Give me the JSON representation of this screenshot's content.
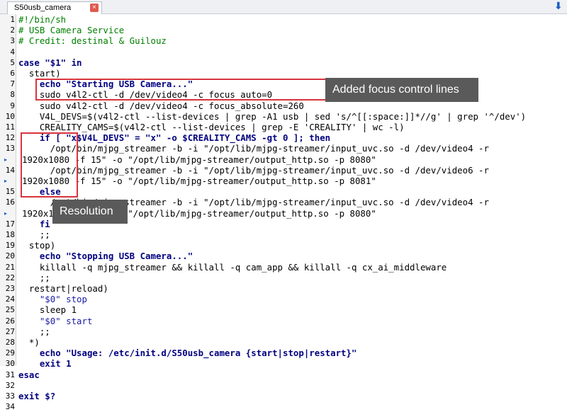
{
  "tab": {
    "label": "S50usb_camera",
    "close": "×"
  },
  "icons": {
    "close": "close-icon",
    "download": "download-arrow-icon",
    "wrap": "wrap-arrow-icon"
  },
  "colors": {
    "highlight": "#d9333d",
    "callout_bg": "#5a5a5a"
  },
  "callouts": {
    "focus": "Added focus control lines",
    "resolution": "Resolution"
  },
  "lines": [
    {
      "n": "1",
      "t": "#!/bin/sh",
      "c": "cm"
    },
    {
      "n": "2",
      "t": "# USB Camera Service",
      "c": "cm"
    },
    {
      "n": "3",
      "t": "# Credit: destinal & Guilouz",
      "c": "cm"
    },
    {
      "n": "4",
      "t": ""
    },
    {
      "n": "5",
      "t": "case \"$1\" in",
      "c": "kw"
    },
    {
      "n": "6",
      "t": "  start)"
    },
    {
      "n": "7",
      "t": "    echo \"Starting USB Camera...\"",
      "c": "kw"
    },
    {
      "n": "8",
      "t": "    sudo v4l2-ctl -d /dev/video4 -c focus_auto=0"
    },
    {
      "n": "9",
      "t": "    sudo v4l2-ctl -d /dev/video4 -c focus_absolute=260"
    },
    {
      "n": "10",
      "t": "    V4L_DEVS=$(v4l2-ctl --list-devices | grep -A1 usb | sed 's/^[[:space:]]*//g' | grep '^/dev')"
    },
    {
      "n": "11",
      "t": "    CREALITY_CAMS=$(v4l2-ctl --list-devices | grep -E 'CREALITY' | wc -l)"
    },
    {
      "n": "12",
      "t": "    if [ \"x$V4L_DEVS\" = \"x\" -o $CREALITY_CAMS -gt 0 ]; then",
      "c": "kw"
    },
    {
      "n": "13",
      "t": "      /opt/bin/mjpg_streamer -b -i \"/opt/lib/mjpg-streamer/input_uvc.so -d /dev/video4 -r"
    },
    {
      "n": "",
      "w": true,
      "t": "1920x1080 -f 15\" -o \"/opt/lib/mjpg-streamer/output_http.so -p 8080\""
    },
    {
      "n": "14",
      "t": "      /opt/bin/mjpg_streamer -b -i \"/opt/lib/mjpg-streamer/input_uvc.so -d /dev/video6 -r"
    },
    {
      "n": "",
      "w": true,
      "t": "1920x1080 -f 15\" -o \"/opt/lib/mjpg-streamer/output_http.so -p 8081\""
    },
    {
      "n": "15",
      "t": "    else",
      "c": "kw"
    },
    {
      "n": "16",
      "t": "      /opt/bin/mjpg_streamer -b -i \"/opt/lib/mjpg-streamer/input_uvc.so -d /dev/video4 -r"
    },
    {
      "n": "",
      "w": true,
      "t": "1920x1080 -f 15\" -o \"/opt/lib/mjpg-streamer/output_http.so -p 8080\""
    },
    {
      "n": "17",
      "t": "    fi",
      "c": "kw"
    },
    {
      "n": "18",
      "t": "    ;;"
    },
    {
      "n": "19",
      "t": "  stop)"
    },
    {
      "n": "20",
      "t": "    echo \"Stopping USB Camera...\"",
      "c": "kw"
    },
    {
      "n": "21",
      "t": "    killall -q mjpg_streamer && killall -q cam_app && killall -q cx_ai_middleware"
    },
    {
      "n": "22",
      "t": "    ;;"
    },
    {
      "n": "23",
      "t": "  restart|reload)"
    },
    {
      "n": "24",
      "t": "    \"$0\" stop",
      "c": "str"
    },
    {
      "n": "25",
      "t": "    sleep 1"
    },
    {
      "n": "26",
      "t": "    \"$0\" start",
      "c": "str"
    },
    {
      "n": "27",
      "t": "    ;;"
    },
    {
      "n": "28",
      "t": "  *)"
    },
    {
      "n": "29",
      "t": "    echo \"Usage: /etc/init.d/S50usb_camera {start|stop|restart}\"",
      "c": "kw"
    },
    {
      "n": "30",
      "t": "    exit 1",
      "c": "kw"
    },
    {
      "n": "31",
      "t": "esac",
      "c": "kw"
    },
    {
      "n": "32",
      "t": ""
    },
    {
      "n": "33",
      "t": "exit $?",
      "c": "kw"
    },
    {
      "n": "34",
      "t": ""
    }
  ]
}
